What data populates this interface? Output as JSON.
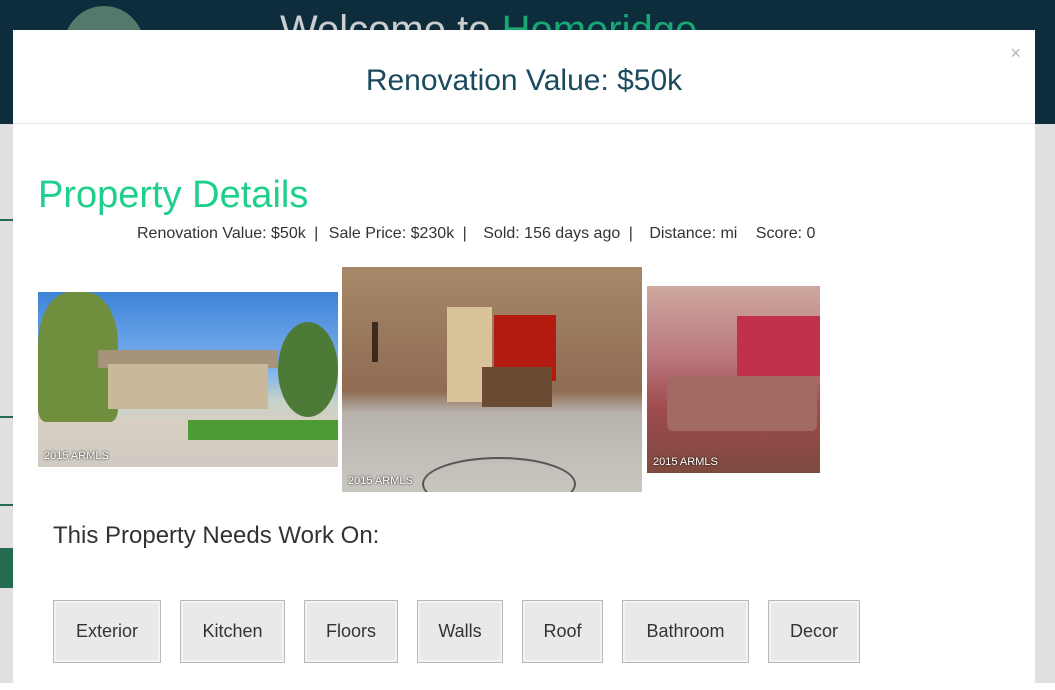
{
  "background": {
    "title_prefix": "Welcome to",
    "title_accent": "Homeridge"
  },
  "modal": {
    "title": "Renovation Value: $50k",
    "close_label": "×"
  },
  "details": {
    "heading": "Property Details",
    "renovation": "Renovation Value: $50k",
    "sale_price": "Sale Price: $230k",
    "sold": "Sold: 156 days ago",
    "distance": "Distance: mi",
    "score": "Score: 0",
    "separator": "|"
  },
  "photos": [
    {
      "icon": "house-exterior-photo",
      "watermark": "2015 ARMLS"
    },
    {
      "icon": "interior-bar-photo",
      "watermark": "2015 ARMLS"
    },
    {
      "icon": "living-room-photo",
      "watermark": "2015 ARMLS"
    }
  ],
  "needs_work": {
    "heading": "This Property Needs Work On:",
    "items": [
      "Exterior",
      "Kitchen",
      "Floors",
      "Walls",
      "Roof",
      "Bathroom",
      "Decor"
    ]
  },
  "colors": {
    "accent": "#1fd08c",
    "header_bg": "#0f3345",
    "title": "#1a4a5e"
  }
}
